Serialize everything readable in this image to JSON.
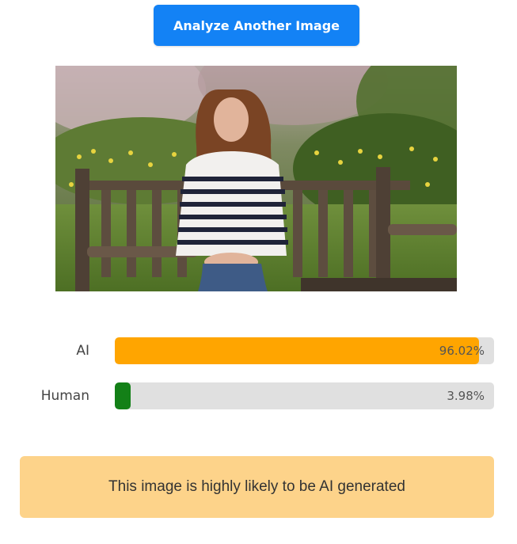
{
  "header": {
    "analyze_button_label": "Analyze Another Image"
  },
  "image": {
    "description_icon": "photo-woman-on-bench"
  },
  "results": [
    {
      "label": "AI",
      "percent_text": "96.02%",
      "value": 0.9602,
      "color": "#ffa500"
    },
    {
      "label": "Human",
      "percent_text": "3.98%",
      "value": 0.0398,
      "color": "#138017"
    }
  ],
  "verdict": {
    "text": "This image is highly likely to be AI generated",
    "color": "#fdd38a"
  },
  "colors": {
    "accent": "#1382f5",
    "track": "#e0e0e0"
  }
}
